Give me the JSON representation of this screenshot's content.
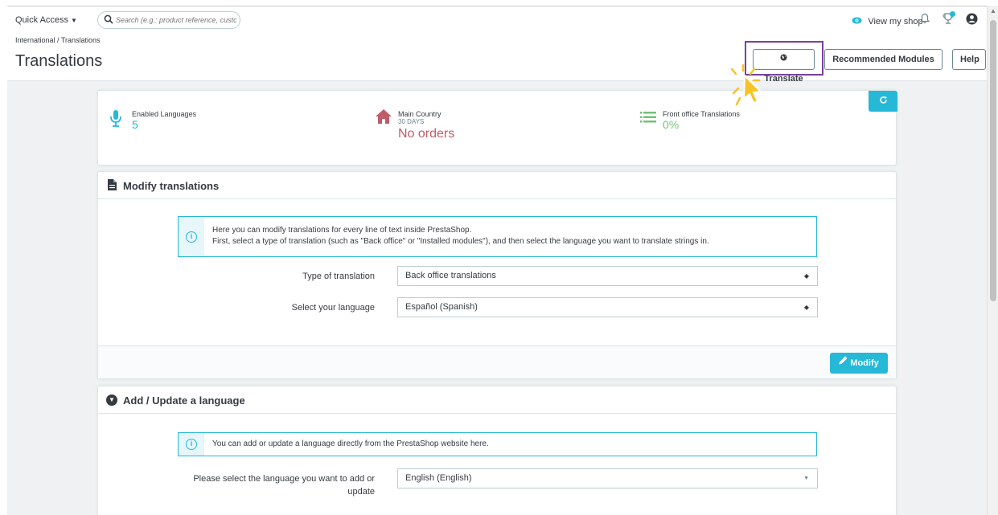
{
  "topbar": {
    "quick_access": "Quick Access",
    "search_placeholder": "Search (e.g.: product reference, custome",
    "view_shop": "View my shop"
  },
  "header": {
    "breadcrumb": "International /  Translations",
    "title": "Translations",
    "buttons": {
      "translate": "Translate",
      "recommended": "Recommended Modules",
      "help": "Help"
    }
  },
  "kpis": [
    {
      "label": "Enabled Languages",
      "sub": "",
      "value": "5",
      "color": "#25b9d7"
    },
    {
      "label": "Main Country",
      "sub": "30 DAYS",
      "value": "No orders",
      "color": "#c05c67"
    },
    {
      "label": "Front office Translations",
      "sub": "",
      "value": "0%",
      "color": "#72c279"
    }
  ],
  "modify_panel": {
    "title": "Modify translations",
    "alert_line1": "Here you can modify translations for every line of text inside PrestaShop.",
    "alert_line2": "First, select a type of translation (such as \"Back office\" or \"Installed modules\"), and then select the language you want to translate strings in.",
    "type_label": "Type of translation",
    "type_value": "Back office translations",
    "language_label": "Select your language",
    "language_value": "Español (Spanish)",
    "modify_button": "Modify"
  },
  "add_panel": {
    "title": "Add / Update a language",
    "alert": "You can add or update a language directly from the PrestaShop website here.",
    "select_label_line1": "Please select the language you want to add or",
    "select_label_line2": "update",
    "select_value": "English (English)"
  },
  "colors": {
    "accent": "#25b9d7",
    "highlight": "#7b3fa0",
    "cursor": "#f7c325"
  }
}
